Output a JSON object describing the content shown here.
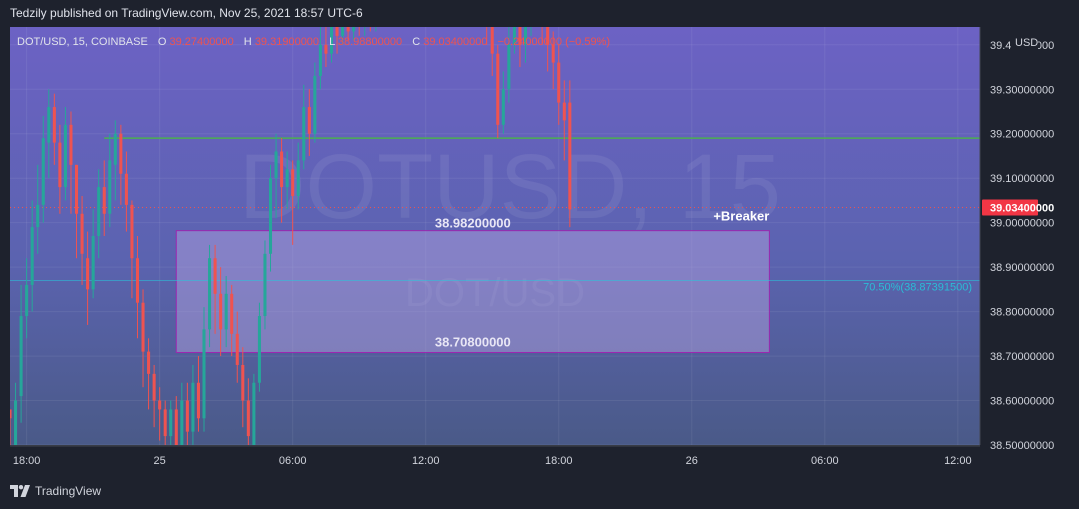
{
  "header": {
    "published": "Tedzily published on TradingView.com, Nov 25, 2021 18:57 UTC-6"
  },
  "footer": {
    "brand": "TradingView",
    "logo_icon": "tradingview-logo-icon"
  },
  "legend": {
    "symbol": "DOT/USD, 15, COINBASE",
    "o_label": "O",
    "o_value": "39.27400000",
    "h_label": "H",
    "h_value": "39.31900000",
    "l_label": "L",
    "l_value": "38.98800000",
    "c_label": "C",
    "c_value": "39.03400000",
    "change": "−0.24000000 (−0.59%)"
  },
  "watermark": {
    "big": "DOTUSD, 15",
    "small": "DOT/USD"
  },
  "colors": {
    "up": "#26a69a",
    "down": "#ef5350",
    "accent": "#f23645",
    "zone_fill": "#b9a6e3",
    "zone_border": "#9c27b0",
    "resistance": "#4caf50",
    "fib_line": "#26c6da"
  },
  "chart_data": {
    "type": "candlestick",
    "ylim": [
      38.5,
      39.44
    ],
    "y_ticks": [
      {
        "value": 39.4,
        "label": "39.40000000"
      },
      {
        "value": 39.3,
        "label": "39.30000000"
      },
      {
        "value": 39.2,
        "label": "39.20000000"
      },
      {
        "value": 39.1,
        "label": "39.10000000"
      },
      {
        "value": 39.0,
        "label": "39.00000000"
      },
      {
        "value": 38.9,
        "label": "38.90000000"
      },
      {
        "value": 38.8,
        "label": "38.80000000"
      },
      {
        "value": 38.7,
        "label": "38.70000000"
      },
      {
        "value": 38.6,
        "label": "38.60000000"
      },
      {
        "value": 38.5,
        "label": "38.50000000"
      }
    ],
    "y_unit": "USD",
    "x_ticks": [
      {
        "index": 3,
        "label": "18:00"
      },
      {
        "index": 27,
        "label": "25"
      },
      {
        "index": 51,
        "label": "06:00"
      },
      {
        "index": 75,
        "label": "12:00"
      },
      {
        "index": 99,
        "label": "18:00"
      },
      {
        "index": 123,
        "label": "26"
      },
      {
        "index": 147,
        "label": "06:00"
      },
      {
        "index": 171,
        "label": "12:00"
      }
    ],
    "x_range": [
      0.5,
      175.5
    ],
    "candles": [
      [
        38.58,
        38.56,
        38.56,
        38.46
      ],
      [
        38.44,
        38.6,
        38.64,
        38.4
      ],
      [
        38.61,
        38.79,
        38.86,
        38.55
      ],
      [
        38.79,
        38.86,
        38.92,
        38.74
      ],
      [
        38.86,
        38.99,
        39.05,
        38.8
      ],
      [
        38.99,
        39.04,
        39.13,
        38.93
      ],
      [
        39.04,
        39.19,
        39.24,
        39.0
      ],
      [
        39.18,
        39.26,
        39.3,
        39.1
      ],
      [
        39.26,
        39.18,
        39.29,
        39.13
      ],
      [
        39.18,
        39.08,
        39.22,
        39.02
      ],
      [
        39.08,
        39.22,
        39.26,
        39.05
      ],
      [
        39.22,
        39.13,
        39.25,
        39.02
      ],
      [
        39.13,
        39.02,
        39.13,
        38.92
      ],
      [
        39.02,
        38.93,
        39.06,
        38.86
      ],
      [
        38.92,
        38.85,
        38.98,
        38.77
      ],
      [
        38.85,
        38.97,
        39.03,
        38.83
      ],
      [
        38.97,
        39.08,
        39.12,
        38.92
      ],
      [
        39.08,
        39.02,
        39.14,
        38.97
      ],
      [
        39.02,
        39.14,
        39.2,
        38.99
      ],
      [
        39.13,
        39.2,
        39.23,
        39.05
      ],
      [
        39.2,
        39.11,
        39.22,
        39.04
      ],
      [
        39.11,
        39.04,
        39.16,
        38.98
      ],
      [
        39.04,
        38.92,
        39.05,
        38.83
      ],
      [
        38.92,
        38.82,
        38.97,
        38.74
      ],
      [
        38.82,
        38.71,
        38.85,
        38.63
      ],
      [
        38.71,
        38.66,
        38.74,
        38.58
      ],
      [
        38.66,
        38.6,
        38.68,
        38.54
      ],
      [
        38.6,
        38.58,
        38.63,
        38.51
      ],
      [
        38.58,
        38.52,
        38.6,
        38.47
      ],
      [
        38.52,
        38.58,
        38.6,
        38.46
      ],
      [
        38.58,
        38.5,
        38.61,
        38.46
      ],
      [
        38.5,
        38.6,
        38.64,
        38.47
      ],
      [
        38.6,
        38.53,
        38.64,
        38.45
      ],
      [
        38.53,
        38.64,
        38.68,
        38.5
      ],
      [
        38.64,
        38.56,
        38.7,
        38.53
      ],
      [
        38.56,
        38.76,
        38.81,
        38.53
      ],
      [
        38.76,
        38.92,
        38.95,
        38.72
      ],
      [
        38.92,
        38.84,
        38.95,
        38.75
      ],
      [
        38.84,
        38.76,
        38.9,
        38.7
      ],
      [
        38.76,
        38.84,
        38.88,
        38.72
      ],
      [
        38.84,
        38.75,
        38.86,
        38.7
      ],
      [
        38.75,
        38.68,
        38.8,
        38.64
      ],
      [
        38.68,
        38.6,
        38.72,
        38.54
      ],
      [
        38.6,
        38.52,
        38.65,
        38.47
      ],
      [
        38.5,
        38.64,
        38.66,
        38.47
      ],
      [
        38.64,
        38.79,
        38.82,
        38.62
      ],
      [
        38.79,
        38.93,
        38.96,
        38.76
      ],
      [
        38.93,
        39.1,
        39.13,
        38.89
      ],
      [
        39.1,
        39.16,
        39.2,
        39.01
      ],
      [
        39.16,
        39.08,
        39.19,
        39.0
      ],
      [
        39.08,
        39.12,
        39.16,
        39.03
      ],
      [
        39.12,
        39.06,
        39.14,
        38.95
      ],
      [
        39.06,
        39.14,
        39.18,
        39.03
      ],
      [
        39.14,
        39.26,
        39.31,
        39.12
      ],
      [
        39.26,
        39.2,
        39.3,
        39.15
      ],
      [
        39.2,
        39.33,
        39.36,
        39.18
      ],
      [
        39.33,
        39.4,
        39.44,
        39.3
      ],
      [
        39.4,
        39.38,
        39.44,
        39.35
      ],
      [
        39.38,
        39.44,
        39.46,
        39.36
      ],
      [
        39.44,
        39.42,
        39.46,
        39.38
      ],
      [
        39.42,
        39.44,
        39.46,
        39.4
      ],
      [
        39.44,
        39.43,
        39.46,
        39.41
      ],
      [
        39.43,
        39.45,
        39.47,
        39.41
      ],
      [
        39.45,
        39.44,
        39.47,
        39.42
      ],
      [
        39.44,
        39.46,
        39.48,
        39.42
      ],
      [
        39.46,
        39.45,
        39.48,
        39.43
      ],
      [
        39.45,
        39.47,
        39.49,
        39.43
      ],
      [
        39.47,
        39.46,
        39.49,
        39.44
      ],
      [
        39.46,
        39.48,
        39.5,
        39.44
      ],
      [
        39.48,
        39.47,
        39.5,
        39.45
      ],
      [
        39.47,
        39.49,
        39.51,
        39.45
      ],
      [
        39.49,
        39.48,
        39.51,
        39.46
      ],
      [
        39.48,
        39.5,
        39.52,
        39.46
      ],
      [
        39.5,
        39.49,
        39.52,
        39.47
      ],
      [
        39.49,
        39.51,
        39.53,
        39.47
      ],
      [
        39.51,
        39.5,
        39.53,
        39.48
      ],
      [
        39.5,
        39.52,
        39.54,
        39.48
      ],
      [
        39.52,
        39.51,
        39.54,
        39.49
      ],
      [
        39.51,
        39.53,
        39.55,
        39.49
      ],
      [
        39.53,
        39.52,
        39.55,
        39.5
      ],
      [
        39.52,
        39.54,
        39.56,
        39.5
      ],
      [
        39.54,
        39.53,
        39.56,
        39.51
      ],
      [
        39.53,
        39.55,
        39.57,
        39.51
      ],
      [
        39.55,
        39.54,
        39.57,
        39.52
      ],
      [
        39.54,
        39.56,
        39.58,
        39.52
      ],
      [
        39.56,
        39.55,
        39.58,
        39.53
      ],
      [
        39.55,
        39.48,
        39.56,
        39.4
      ],
      [
        39.48,
        39.38,
        39.5,
        39.33
      ],
      [
        39.38,
        39.22,
        39.4,
        39.19
      ],
      [
        39.22,
        39.3,
        39.34,
        39.2
      ],
      [
        39.3,
        39.4,
        39.45,
        39.27
      ],
      [
        39.4,
        39.46,
        39.5,
        39.38
      ],
      [
        39.46,
        39.4,
        39.48,
        39.35
      ],
      [
        39.4,
        39.44,
        39.47,
        39.36
      ],
      [
        39.44,
        39.52,
        39.56,
        39.42
      ],
      [
        39.52,
        39.48,
        39.55,
        39.44
      ],
      [
        39.48,
        39.46,
        39.52,
        39.4
      ],
      [
        39.46,
        39.4,
        39.48,
        39.34
      ],
      [
        39.4,
        39.36,
        39.43,
        39.3
      ],
      [
        39.36,
        39.27,
        39.4,
        39.22
      ],
      [
        39.27,
        39.23,
        39.32,
        39.14
      ],
      [
        39.27,
        39.03,
        39.32,
        38.99
      ]
    ],
    "levels": [
      {
        "name": "resistance",
        "value": 39.19,
        "x_start": 17
      },
      {
        "name": "fib",
        "value": 38.87,
        "x_start": 0,
        "label": "70.50%(38.87391500)"
      },
      {
        "name": "last_price",
        "value": 39.034,
        "label": "39.03400000"
      }
    ],
    "zone": {
      "top": 38.982,
      "bottom": 38.708,
      "x_start": 30,
      "x_end": 137,
      "top_label": "38.98200000",
      "bottom_label": "38.70800000",
      "tag": "+Breaker"
    },
    "grid": true
  }
}
